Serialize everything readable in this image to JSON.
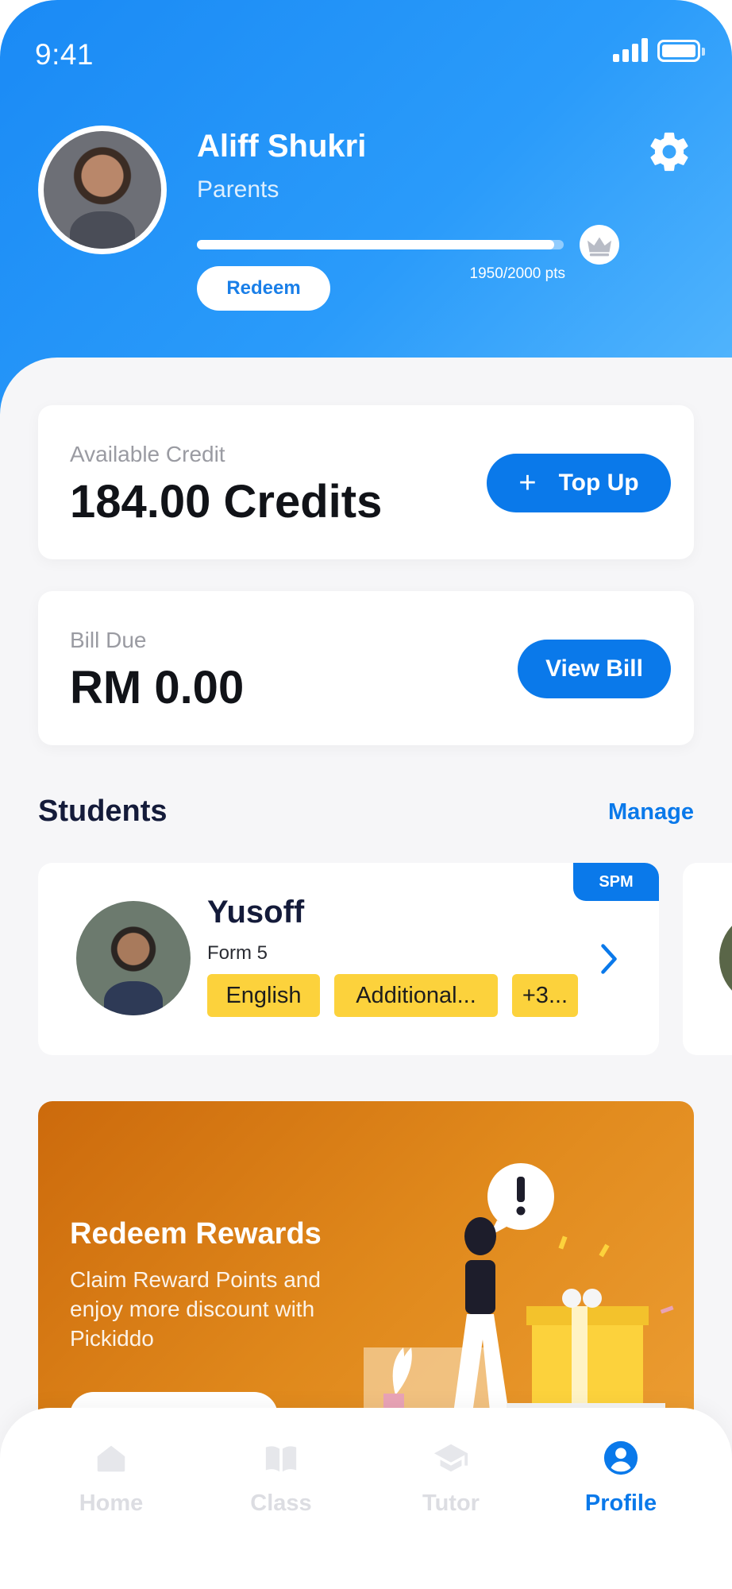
{
  "status_bar": {
    "time": "9:41"
  },
  "profile": {
    "name": "Aliff Shukri",
    "role": "Parents",
    "points_text": "1950/2000 pts",
    "points_progress": 0.975,
    "redeem_label": "Redeem"
  },
  "credit_card": {
    "label": "Available Credit",
    "value": "184.00 Credits",
    "button_label": "Top Up",
    "button_icon": "+"
  },
  "bill_card": {
    "label": "Bill Due",
    "value": "RM 0.00",
    "button_label": "View Bill"
  },
  "students_section": {
    "title": "Students",
    "manage_label": "Manage",
    "students": [
      {
        "name": "Yusoff",
        "form": "Form 5",
        "level_tag": "SPM",
        "subjects": [
          "English",
          "Additional...",
          "+3..."
        ]
      }
    ]
  },
  "banner": {
    "title": "Redeem Rewards",
    "description": "Claim Reward Points and enjoy more discount with Pickiddo"
  },
  "bottom_nav": {
    "items": [
      {
        "label": "Home",
        "icon": "home-icon",
        "active": false
      },
      {
        "label": "Class",
        "icon": "book-icon",
        "active": false
      },
      {
        "label": "Tutor",
        "icon": "graduation-cap-icon",
        "active": false
      },
      {
        "label": "Profile",
        "icon": "user-icon",
        "active": true
      }
    ]
  },
  "colors": {
    "primary": "#0a79ea",
    "header": "#1a8af5",
    "tag": "#fcd23c",
    "banner": "#e0891c"
  }
}
